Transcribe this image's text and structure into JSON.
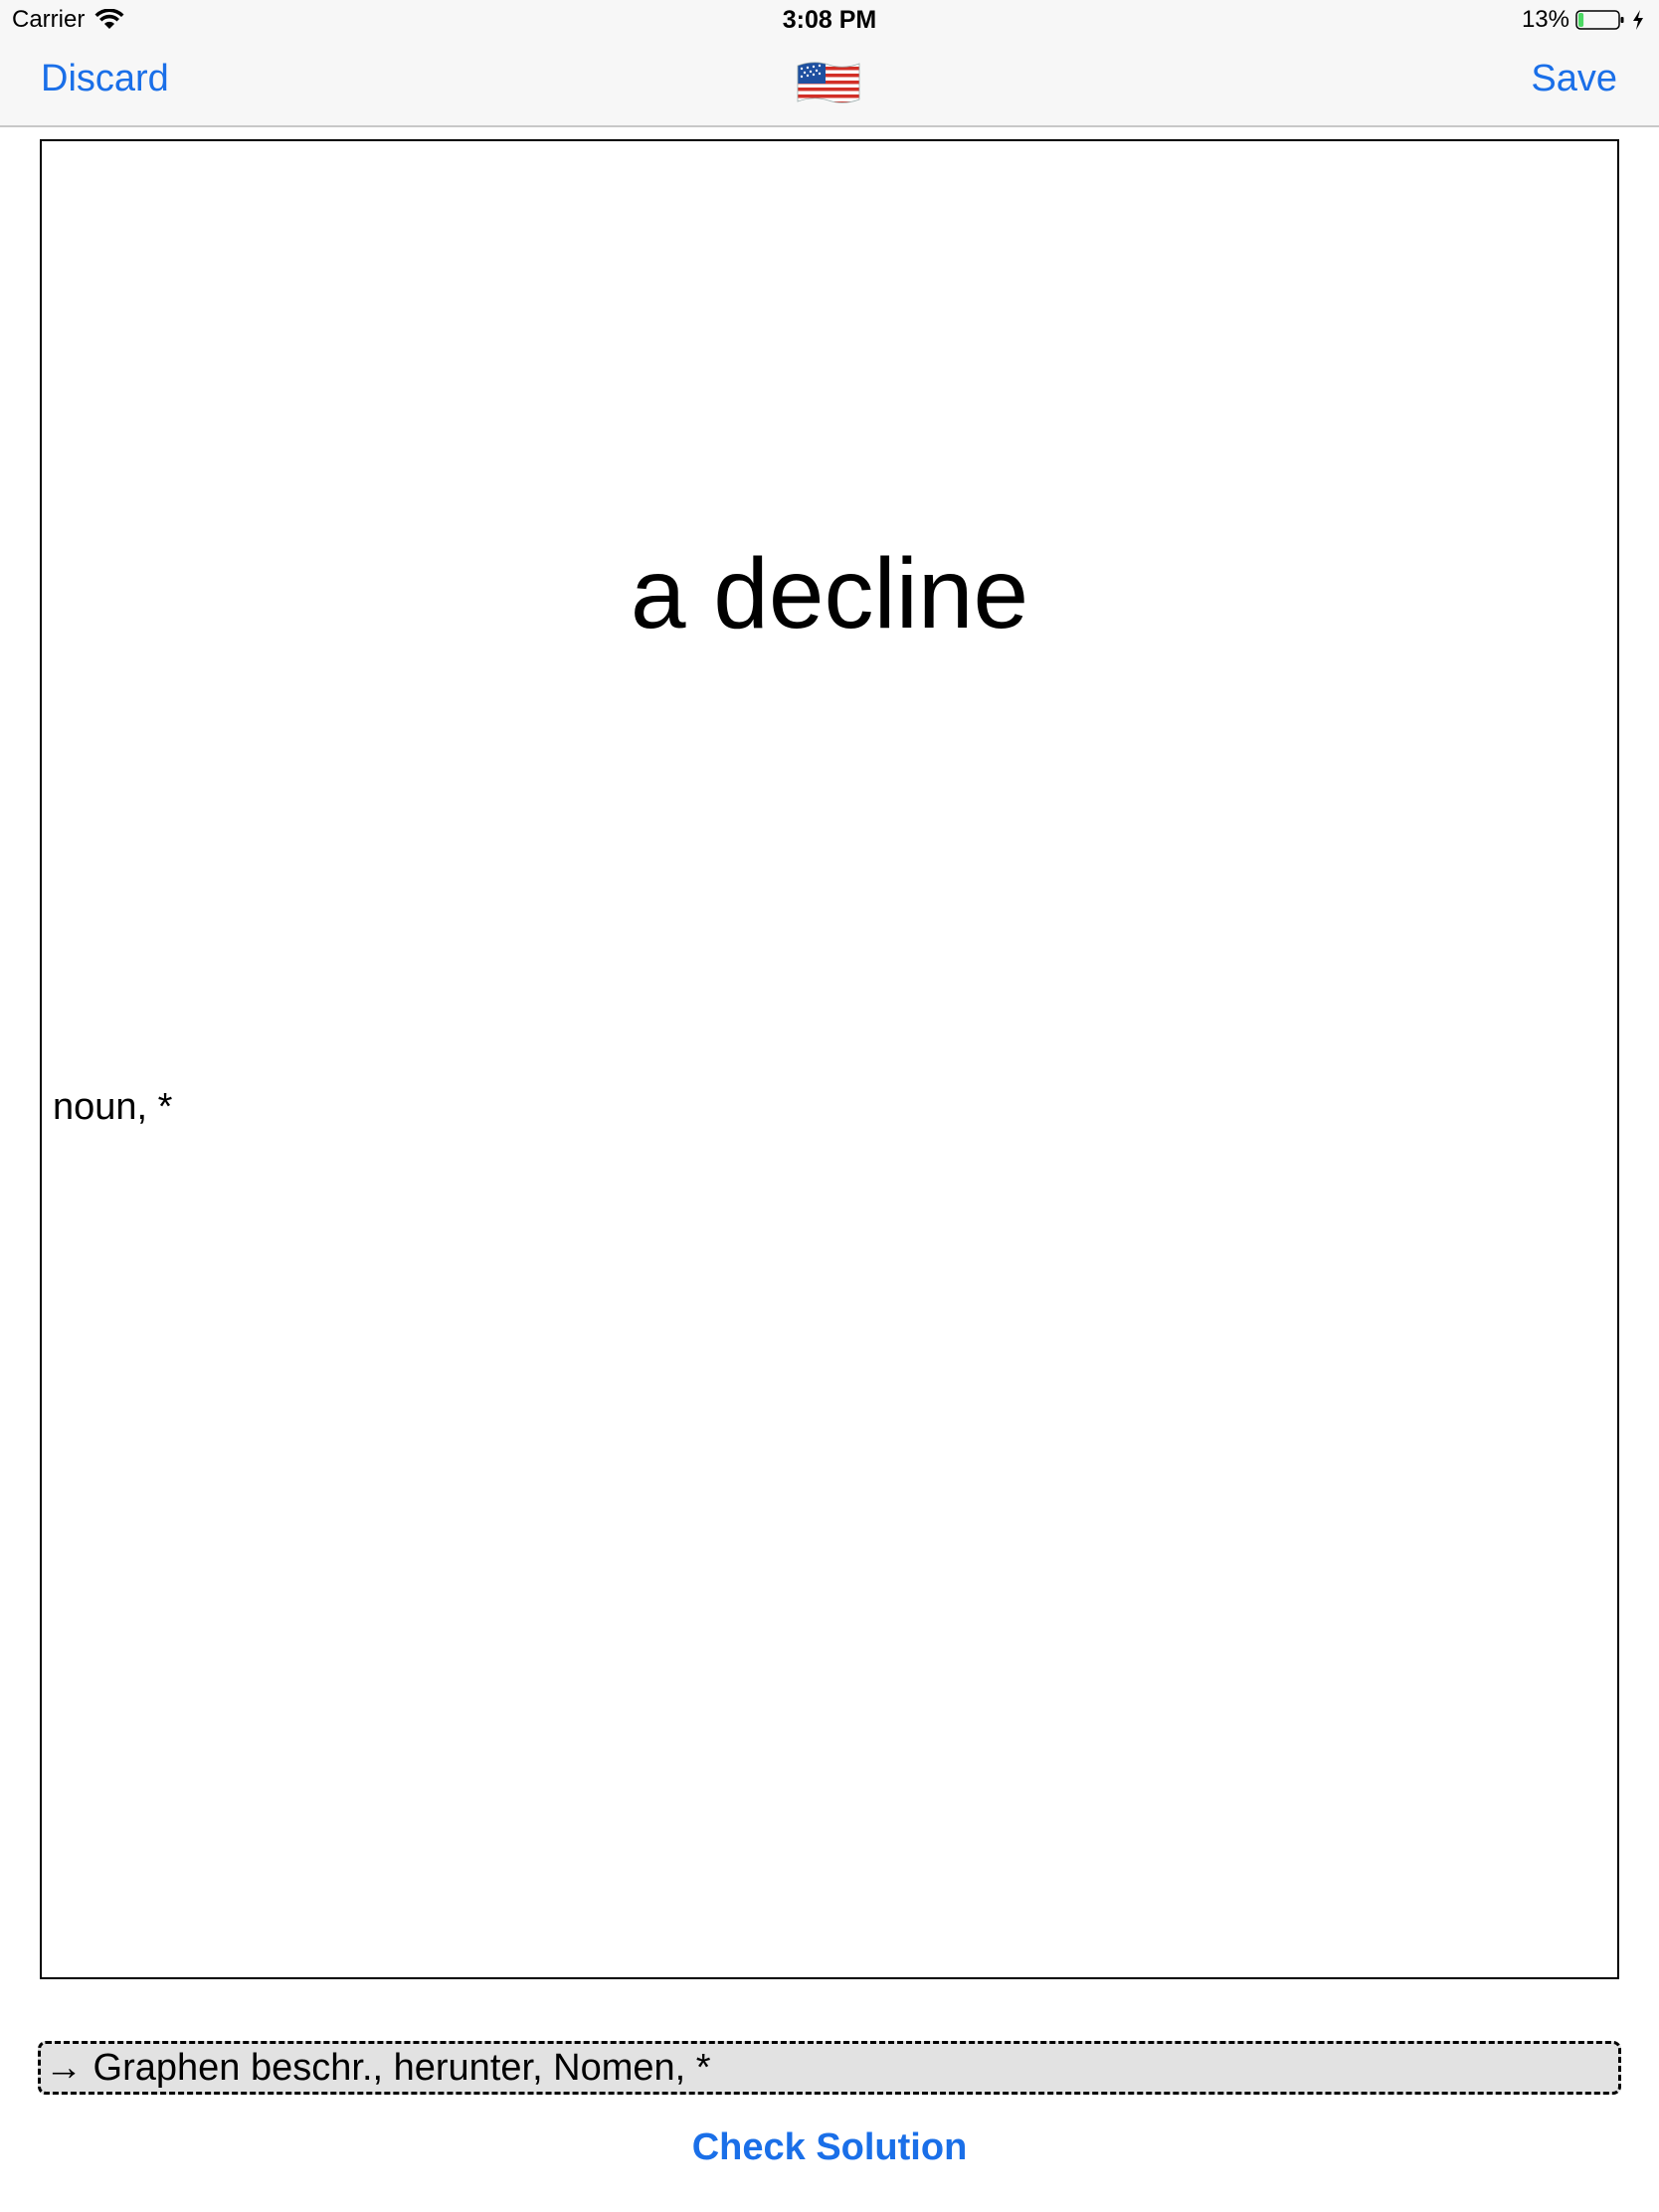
{
  "status_bar": {
    "carrier": "Carrier",
    "time": "3:08 PM",
    "battery_percent": "13%",
    "battery_level": 0.13
  },
  "nav": {
    "discard_label": "Discard",
    "save_label": "Save",
    "language_flag": "🇺🇸"
  },
  "card": {
    "word": "a decline",
    "word_type": "noun, *"
  },
  "answer": {
    "value": "→ Graphen beschr., herunter, Nomen, *"
  },
  "check_label": "Check Solution",
  "colors": {
    "accent": "#1a6fe8",
    "battery_fill": "#4cd964"
  }
}
